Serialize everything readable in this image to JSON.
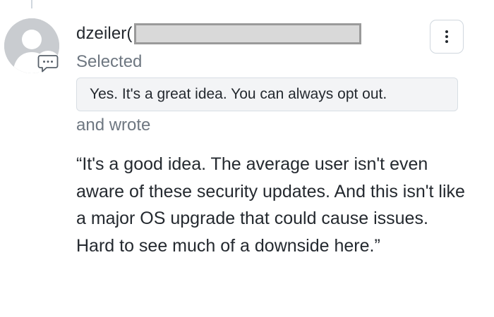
{
  "comment": {
    "username": "dzeiler(",
    "selected_label": "Selected",
    "selected_option": "Yes. It's a great idea. You can always opt out.",
    "wrote_label": "and wrote",
    "body": "“It's a good idea. The average user isn't even aware of these security updates. And this isn't like a major OS upgrade that could cause issues. Hard to see much of a downside here.”"
  },
  "icons": {
    "avatar": "default-user-avatar",
    "badge": "comment-icon",
    "menu": "kebab-menu-icon"
  },
  "colors": {
    "text_primary": "#24292f",
    "text_secondary": "#6e7781",
    "avatar_bg": "#c9ccd0",
    "option_bg": "#f3f4f6",
    "border": "#d0d7de",
    "redaction": "#9a9a9a"
  }
}
